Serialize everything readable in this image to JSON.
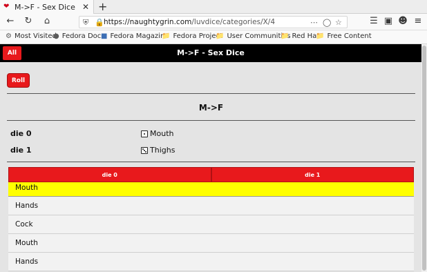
{
  "browser": {
    "tab_title": "M->F - Sex Dice",
    "url_host": "https://naughtygrin.com",
    "url_path": "/luvdice/categories/X/4",
    "bookmarks": [
      "Most Visited",
      "Fedora Docs",
      "Fedora Magazine",
      "Fedora Project",
      "User Communities",
      "Red Hat",
      "Free Content"
    ]
  },
  "app": {
    "all_button": "All",
    "title": "M->F - Sex Dice",
    "roll_button": "Roll",
    "section_title": "M->F",
    "dice": [
      {
        "label": "die 0",
        "value": "Mouth",
        "face": 1
      },
      {
        "label": "die 1",
        "value": "Thighs",
        "face": 3
      }
    ],
    "results": {
      "headers": [
        "die 0",
        "die 1"
      ],
      "rows": [
        "Mouth",
        "Hands",
        "Cock",
        "Mouth",
        "Hands"
      ]
    },
    "colors": {
      "accent_red": "#e8191c",
      "highlight": "#ffff00",
      "header_bg": "#000000"
    }
  }
}
